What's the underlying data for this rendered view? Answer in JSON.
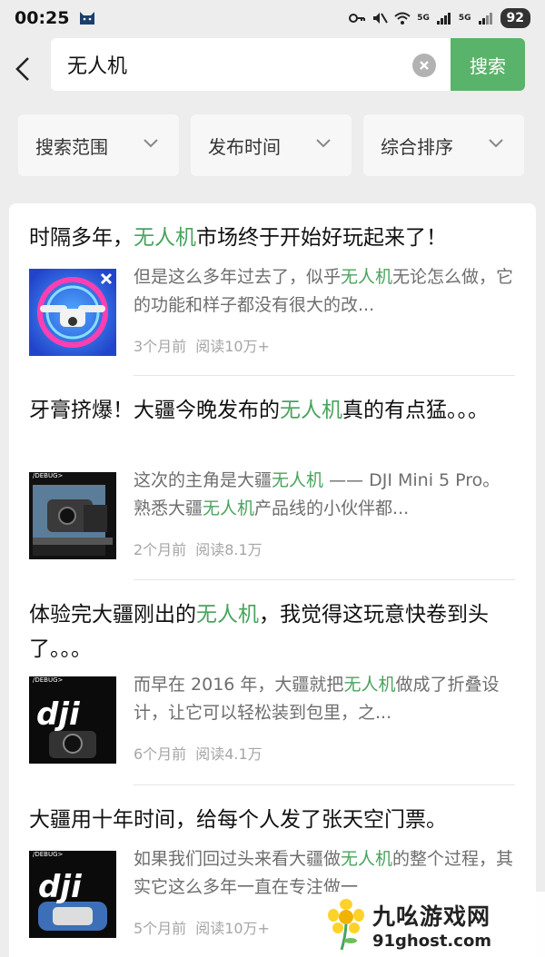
{
  "status": {
    "time": "00:25",
    "battery": "92",
    "net1": "5G",
    "net2": "5G"
  },
  "search": {
    "value": "无人机",
    "placeholder": "搜索",
    "button_label": "搜索"
  },
  "filters": [
    "搜索范围",
    "发布时间",
    "综合排序"
  ],
  "results": [
    {
      "title_pre": "时隔多年，",
      "title_hl": "无人机",
      "title_post": "市场终于开始好玩起来了！",
      "snippet_pre": "但是这么多年过去了，似乎",
      "snippet_hl": "无人机",
      "snippet_post": "无论怎么做，它的功能和样子都没有很大的改...",
      "time": "3个月前",
      "reads": "阅读10万+",
      "thumb": "drone-360"
    },
    {
      "title_pre": "牙膏挤爆！大疆今晚发布的",
      "title_hl": "无人机",
      "title_post": "真的有点猛。。。",
      "snippet_pre": "这次的主角是大疆",
      "snippet_hl": "无人机",
      "snippet_mid": " —— DJI Mini 5 Pro。熟悉大疆",
      "snippet_hl2": "无人机",
      "snippet_post": "产品线的小伙伴都...",
      "time": "2个月前",
      "reads": "阅读8.1万",
      "thumb_tag": "/DEBUG>"
    },
    {
      "title_pre": "体验完大疆刚出的",
      "title_hl": "无人机",
      "title_post": "，我觉得这玩意快卷到头了。。。",
      "snippet_pre": "而早在 2016 年，大疆就把",
      "snippet_hl": "无人机",
      "snippet_post": "做成了折叠设计，让它可以轻松装到包里，之...",
      "time": "6个月前",
      "reads": "阅读4.1万",
      "thumb_tag": "/DEBUG>",
      "thumb_logo": "dji"
    },
    {
      "title_pre": "大疆用十年时间，给每个人发了张天空门票。",
      "title_hl": "",
      "title_post": "",
      "snippet_pre": "如果我们回过头来看大疆做",
      "snippet_hl": "无人机",
      "snippet_post": "的整个过程，其实它这么多年一直在专注做一",
      "time": "5个月前",
      "reads": "阅读10万+",
      "thumb_tag": "/DEBUG>",
      "thumb_logo": "dji"
    }
  ],
  "watermark": {
    "cn": "九吆游戏网",
    "url": "91ghost.com"
  },
  "colors": {
    "accent": "#5ab36a",
    "highlight": "#4aa35e"
  }
}
